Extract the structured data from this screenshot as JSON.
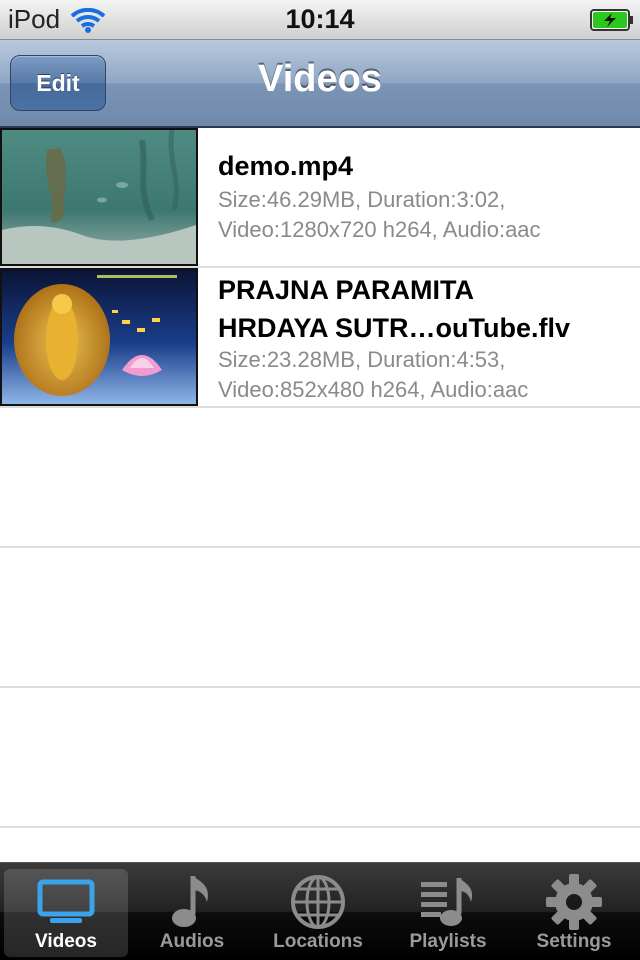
{
  "status_bar": {
    "carrier": "iPod",
    "time": "10:14"
  },
  "nav_bar": {
    "edit_label": "Edit",
    "title": "Videos"
  },
  "videos": [
    {
      "title": "demo.mp4",
      "detail_line1": "Size:46.29MB, Duration:3:02,",
      "detail_line2": "Video:1280x720 h264, Audio:aac"
    },
    {
      "title_line1": "PRAJNA PARAMITA",
      "title_line2": "HRDAYA SUTR…ouTube.flv",
      "detail_line1": "Size:23.28MB, Duration:4:53,",
      "detail_line2": "Video:852x480 h264, Audio:aac"
    }
  ],
  "tabs": [
    {
      "label": "Videos",
      "icon": "monitor-icon",
      "selected": true
    },
    {
      "label": "Audios",
      "icon": "music-note-icon",
      "selected": false
    },
    {
      "label": "Locations",
      "icon": "globe-icon",
      "selected": false
    },
    {
      "label": "Playlists",
      "icon": "playlist-icon",
      "selected": false
    },
    {
      "label": "Settings",
      "icon": "gear-icon",
      "selected": false
    }
  ],
  "colors": {
    "nav_bar": "#7c95b6",
    "selected_tab_icon": "#3aa3ea",
    "detail_text": "#8a8a8a",
    "battery_fill": "#29c91d"
  }
}
